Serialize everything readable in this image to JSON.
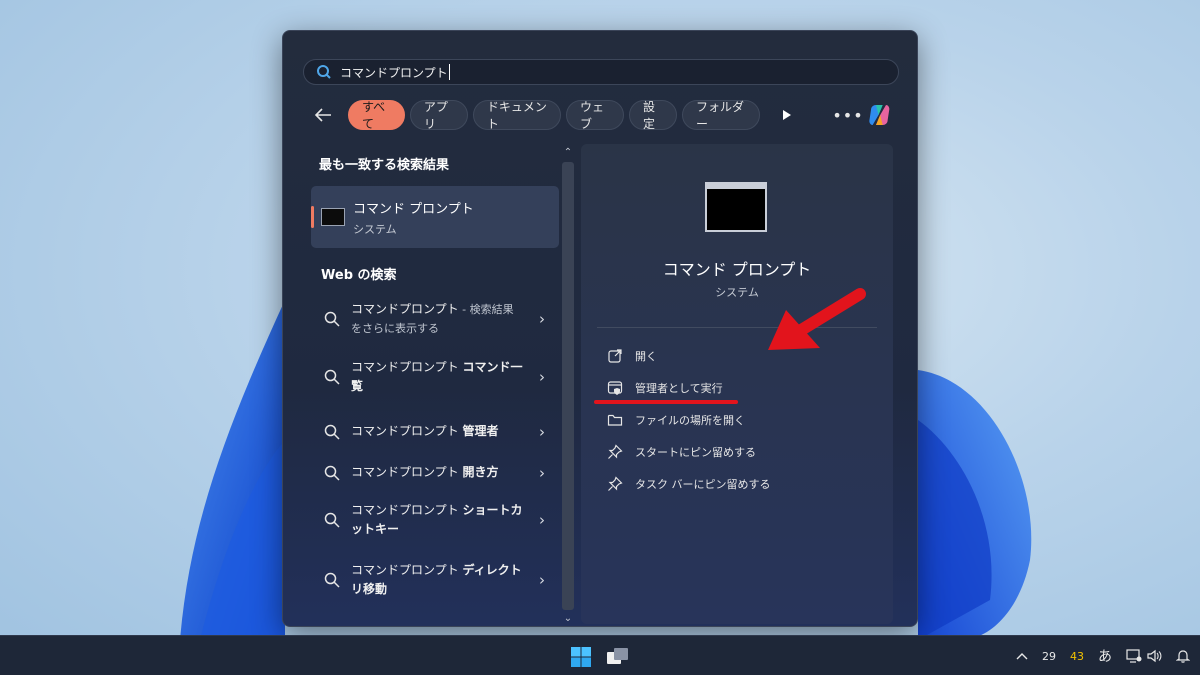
{
  "search": {
    "query": "コマンドプロンプト"
  },
  "filters": [
    {
      "label": "すべて",
      "active": true
    },
    {
      "label": "アプリ",
      "active": false
    },
    {
      "label": "ドキュメント",
      "active": false
    },
    {
      "label": "ウェブ",
      "active": false
    },
    {
      "label": "設定",
      "active": false
    },
    {
      "label": "フォルダー",
      "active": false
    }
  ],
  "more_label": "•••",
  "left": {
    "best_match_heading": "最も一致する検索結果",
    "best_match": {
      "title": "コマンド プロンプト",
      "subtitle": "システム"
    },
    "web_heading": "Web の検索",
    "web_items": [
      {
        "prefix": "コマンドプロンプト",
        "suffix": " - 検索結果",
        "line2": "をさらに表示する"
      },
      {
        "prefix": "コマンドプロンプト ",
        "bold": "コマンド一覧"
      },
      {
        "prefix": "コマンドプロンプト ",
        "bold": "管理者"
      },
      {
        "prefix": "コマンドプロンプト ",
        "bold": "開き方"
      },
      {
        "prefix": "コマンドプロンプト ",
        "bold": "ショートカットキー"
      },
      {
        "prefix": "コマンドプロンプト ",
        "bold": "ディレクトリ移動"
      }
    ]
  },
  "right": {
    "title": "コマンド プロンプト",
    "subtitle": "システム",
    "actions": [
      {
        "label": "開く",
        "icon": "open-external-icon"
      },
      {
        "label": "管理者として実行",
        "icon": "shield-window-icon"
      },
      {
        "label": "ファイルの場所を開く",
        "icon": "folder-icon"
      },
      {
        "label": "スタートにピン留めする",
        "icon": "pin-icon"
      },
      {
        "label": "タスク バーにピン留めする",
        "icon": "pin-icon"
      }
    ]
  },
  "tray": {
    "num1": "29",
    "num2": "43",
    "ime": "あ"
  },
  "colors": {
    "accent": "#ef7b62",
    "annotation_red": "#e2141c"
  }
}
